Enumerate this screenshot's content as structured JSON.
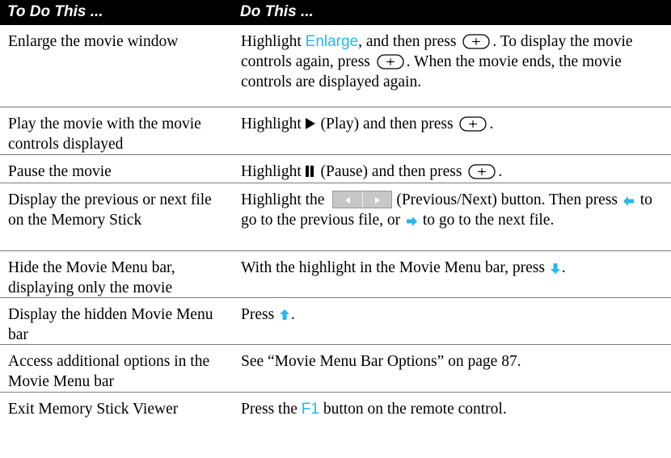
{
  "header": {
    "col1": "To Do This ...",
    "col2": "Do This ..."
  },
  "rows": [
    {
      "action": "Enlarge the movie window",
      "p1": "Highlight ",
      "kw": "Enlarge",
      "p2": ", and then press ",
      "p3": ". To display the movie controls again, press ",
      "p4": ". When the movie ends, the movie controls are displayed again."
    },
    {
      "action": "Play the movie with the movie controls displayed",
      "p1": "Highlight ",
      "p2": "(Play) and then press ",
      "p3": "."
    },
    {
      "action": "Pause the movie",
      "p1": "Highlight ",
      "p2": "(Pause) and then press ",
      "p3": "."
    },
    {
      "action": "Display the previous or next file on the Memory Stick",
      "p1": "Highlight the ",
      "p2": "(Previous/Next) button. Then press ",
      "p3": " to go to the previous file, or ",
      "p4": " to go to the next file."
    },
    {
      "action": "Hide the Movie Menu bar, displaying only the movie",
      "p1": "With the highlight in the Movie Menu bar, press ",
      "p2": "."
    },
    {
      "action": "Display the hidden Movie Menu bar",
      "p1": "Press ",
      "p2": "."
    },
    {
      "action": "Access additional options in the Movie Menu bar",
      "p1": "See “Movie Menu Bar Options” on page 87."
    },
    {
      "action": "Exit Memory Stick Viewer",
      "p1": "Press the ",
      "kw": "F1",
      "p2": " button on the remote control."
    }
  ],
  "colors": {
    "keyword": "#22b8f0",
    "header_bg": "#000000",
    "header_text": "#ffffff",
    "arrow": "#22b8f0"
  },
  "icons": [
    "enter-button-icon",
    "play-icon",
    "pause-icon",
    "previous-next-button-icon",
    "left-arrow-icon",
    "right-arrow-icon",
    "down-arrow-icon",
    "up-arrow-icon"
  ]
}
